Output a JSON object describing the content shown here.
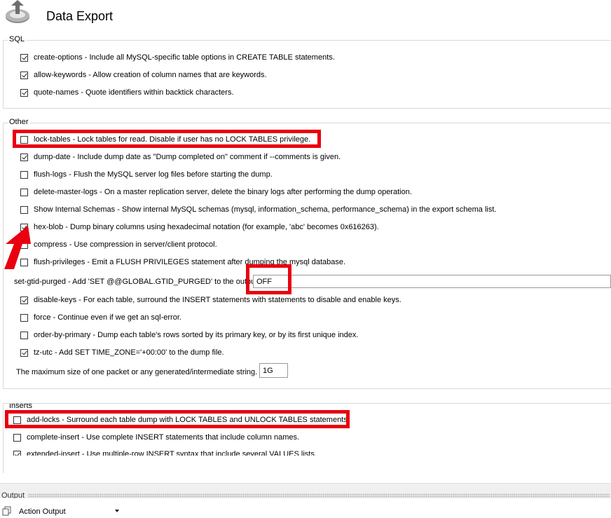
{
  "header": {
    "title": "Data Export",
    "icon": "export-upload-icon"
  },
  "sections": {
    "sql": {
      "label": "SQL",
      "options": [
        {
          "text": "create-options - Include all MySQL-specific table options in CREATE TABLE statements.",
          "checked": true
        },
        {
          "text": "allow-keywords - Allow creation of column names that are keywords.",
          "checked": true
        },
        {
          "text": "quote-names - Quote identifiers within backtick characters.",
          "checked": true
        }
      ]
    },
    "other": {
      "label": "Other",
      "options": [
        {
          "text": "lock-tables - Lock tables for read. Disable if user has no LOCK TABLES privilege.",
          "checked": false
        },
        {
          "text": "dump-date - Include dump date as \"Dump completed on\" comment if --comments is given.",
          "checked": true
        },
        {
          "text": "flush-logs - Flush the MySQL server log files before starting the dump.",
          "checked": false
        },
        {
          "text": "delete-master-logs - On a master replication server, delete the binary logs after performing the dump operation.",
          "checked": false
        },
        {
          "text": "Show Internal Schemas - Show internal MySQL schemas (mysql, information_schema, performance_schema) in the export schema list.",
          "checked": false
        },
        {
          "text": "hex-blob - Dump binary columns using hexadecimal notation (for example, 'abc' becomes 0x616263).",
          "checked": true
        },
        {
          "text": "compress - Use compression in server/client protocol.",
          "checked": false
        },
        {
          "text": "flush-privileges - Emit a FLUSH PRIVILEGES statement after dumping the mysql database.",
          "checked": false
        }
      ],
      "gtid": {
        "label": "set-gtid-purged - Add 'SET @@GLOBAL.GTID_PURGED' to the output",
        "value": "OFF"
      },
      "options2": [
        {
          "text": "disable-keys - For each table, surround the INSERT statements with statements to disable and enable keys.",
          "checked": true
        },
        {
          "text": "force - Continue even if we get an sql-error.",
          "checked": false
        },
        {
          "text": "order-by-primary - Dump each table's rows sorted by its primary key, or by its first unique index.",
          "checked": false
        },
        {
          "text": "tz-utc - Add SET TIME_ZONE='+00:00' to the dump file.",
          "checked": true
        }
      ],
      "packet": {
        "label": "The maximum size of one packet or any generated/intermediate string.",
        "value": "1G"
      }
    },
    "inserts": {
      "label": "Inserts",
      "options": [
        {
          "text": "add-locks - Surround each table dump with LOCK TABLES and UNLOCK TABLES statements.",
          "checked": false
        },
        {
          "text": "complete-insert - Use complete INSERT statements that include column names.",
          "checked": false
        },
        {
          "text": "extended-insert - Use multiple-row INSERT syntax that include several VALUES lists.",
          "checked": true
        }
      ]
    }
  },
  "output": {
    "label": "Output",
    "selected": "Action Output",
    "icon": "copy-icon"
  },
  "colors": {
    "highlight": "#e8000f"
  }
}
